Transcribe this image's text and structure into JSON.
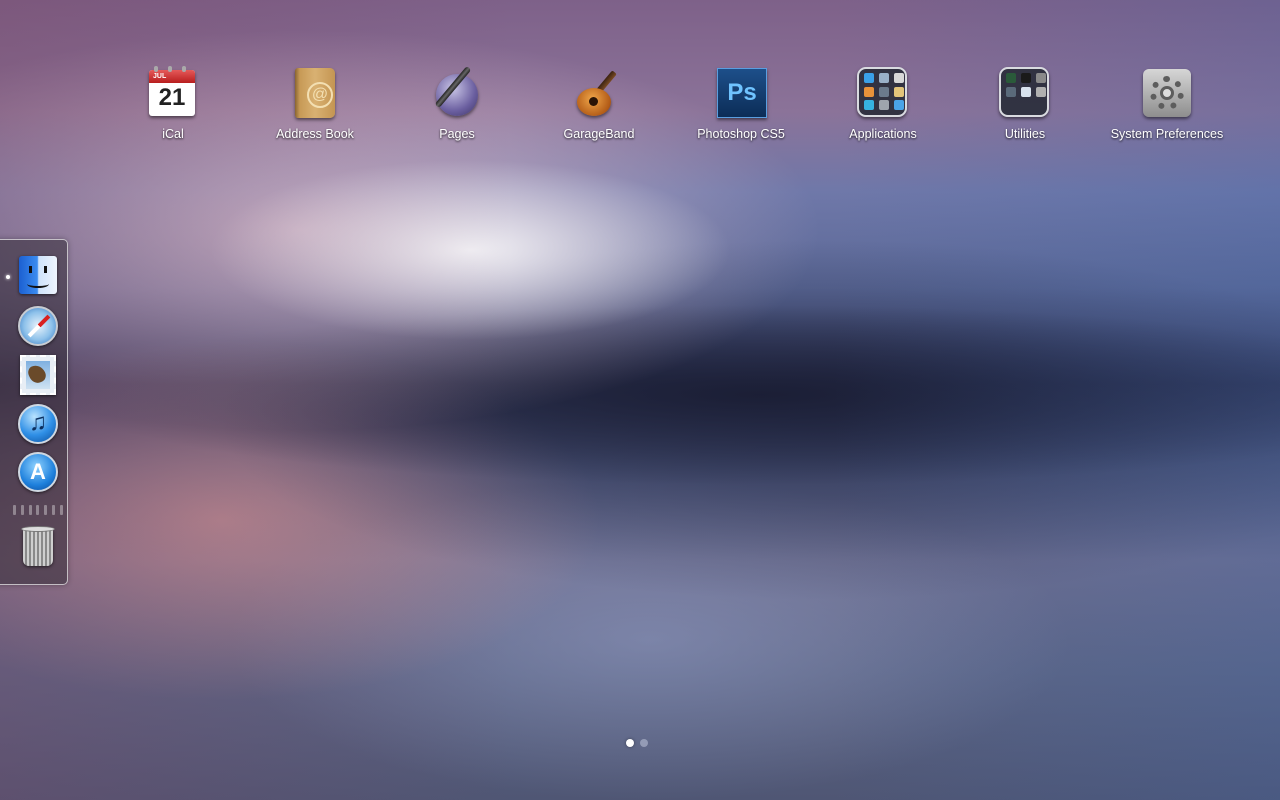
{
  "launchpad": {
    "apps": [
      {
        "label": "iCal",
        "icon": "ical-icon",
        "date_month": "JUL",
        "date_day": "21"
      },
      {
        "label": "Address Book",
        "icon": "address-book-icon",
        "glyph": "@"
      },
      {
        "label": "Pages",
        "icon": "pages-icon"
      },
      {
        "label": "GarageBand",
        "icon": "garageband-icon"
      },
      {
        "label": "Photoshop CS5",
        "icon": "photoshop-icon",
        "glyph": "Ps"
      },
      {
        "label": "Applications",
        "icon": "folder-icon"
      },
      {
        "label": "Utilities",
        "icon": "folder-icon"
      },
      {
        "label": "System Preferences",
        "icon": "system-preferences-icon"
      }
    ],
    "pages": {
      "total": 2,
      "current": 1
    }
  },
  "dock": {
    "position": "left",
    "items": [
      {
        "name": "Finder",
        "icon": "finder-icon",
        "running": true
      },
      {
        "name": "Safari",
        "icon": "safari-icon",
        "running": false
      },
      {
        "name": "Mail",
        "icon": "mail-icon",
        "running": false
      },
      {
        "name": "iTunes",
        "icon": "itunes-icon",
        "glyph": "♫",
        "running": false
      },
      {
        "name": "App Store",
        "icon": "app-store-icon",
        "glyph": "A",
        "running": false
      },
      {
        "name": "Trash",
        "icon": "trash-icon",
        "running": false
      }
    ]
  },
  "colors": {
    "label_text": "#ffffff",
    "dock_border": "#ffffff",
    "active_page_dot": "#ffffff"
  }
}
